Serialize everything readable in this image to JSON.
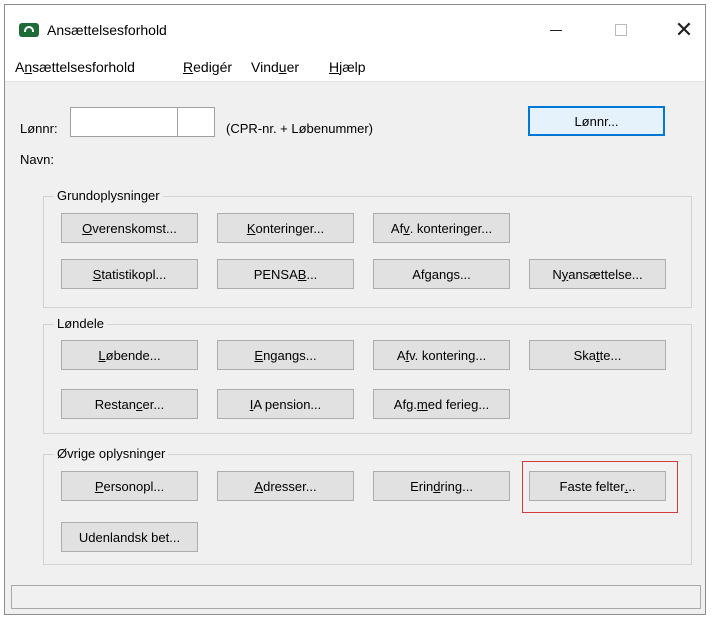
{
  "window": {
    "title": "Ansættelsesforhold"
  },
  "menu": [
    {
      "pre": "A",
      "ul": "n",
      "post": "sættelsesforhold"
    },
    {
      "pre": "",
      "ul": "R",
      "post": "edigér"
    },
    {
      "pre": "Vind",
      "ul": "u",
      "post": "er"
    },
    {
      "pre": "",
      "ul": "H",
      "post": "jælp"
    }
  ],
  "top": {
    "lonnr_label": "Lønnr:",
    "cpr_field_value": "",
    "lobenr_field_value": "",
    "hint": "(CPR-nr. + Løbenummer)",
    "navn_label": "Navn:",
    "lonnr_button": "Lønnr..."
  },
  "groups": {
    "grundoplysninger": {
      "title": "Grundoplysninger",
      "buttons": [
        {
          "pre": "",
          "ul": "O",
          "post": "verenskomst..."
        },
        {
          "pre": "",
          "ul": "K",
          "post": "onteringer..."
        },
        {
          "pre": "Af",
          "ul": "v",
          "post": ". konteringer..."
        },
        {
          "pre": "",
          "ul": "S",
          "post": "tatistikopl..."
        },
        {
          "pre": "PENSA",
          "ul": "B",
          "post": "..."
        },
        {
          "pre": "Af",
          "ul": "g",
          "post": "angs..."
        },
        {
          "pre": "N",
          "ul": "y",
          "post": "ansættelse..."
        }
      ]
    },
    "londele": {
      "title": "Løndele",
      "buttons": [
        {
          "pre": "",
          "ul": "L",
          "post": "øbende..."
        },
        {
          "pre": "",
          "ul": "E",
          "post": "ngangs..."
        },
        {
          "pre": "A",
          "ul": "f",
          "post": "v. kontering..."
        },
        {
          "pre": "Ska",
          "ul": "t",
          "post": "te..."
        },
        {
          "pre": "Restan",
          "ul": "c",
          "post": "er..."
        },
        {
          "pre": "",
          "ul": "I",
          "post": "A pension..."
        },
        {
          "pre": "Afg. ",
          "ul": "m",
          "post": "ed ferieg..."
        }
      ]
    },
    "ovrige": {
      "title": "Øvrige oplysninger",
      "buttons": [
        {
          "pre": "",
          "ul": "P",
          "post": "ersonopl..."
        },
        {
          "pre": "",
          "ul": "A",
          "post": "dresser..."
        },
        {
          "pre": "Erin",
          "ul": "d",
          "post": "ring..."
        },
        {
          "pre": "Faste felter",
          "ul": ".",
          "post": ".."
        },
        {
          "pre": "Udenlandsk bet...",
          "ul": "",
          "post": ""
        }
      ]
    }
  },
  "status": {
    "text": ""
  },
  "colors": {
    "highlight": "#d23b3b",
    "default_button_border": "#0078d7"
  }
}
